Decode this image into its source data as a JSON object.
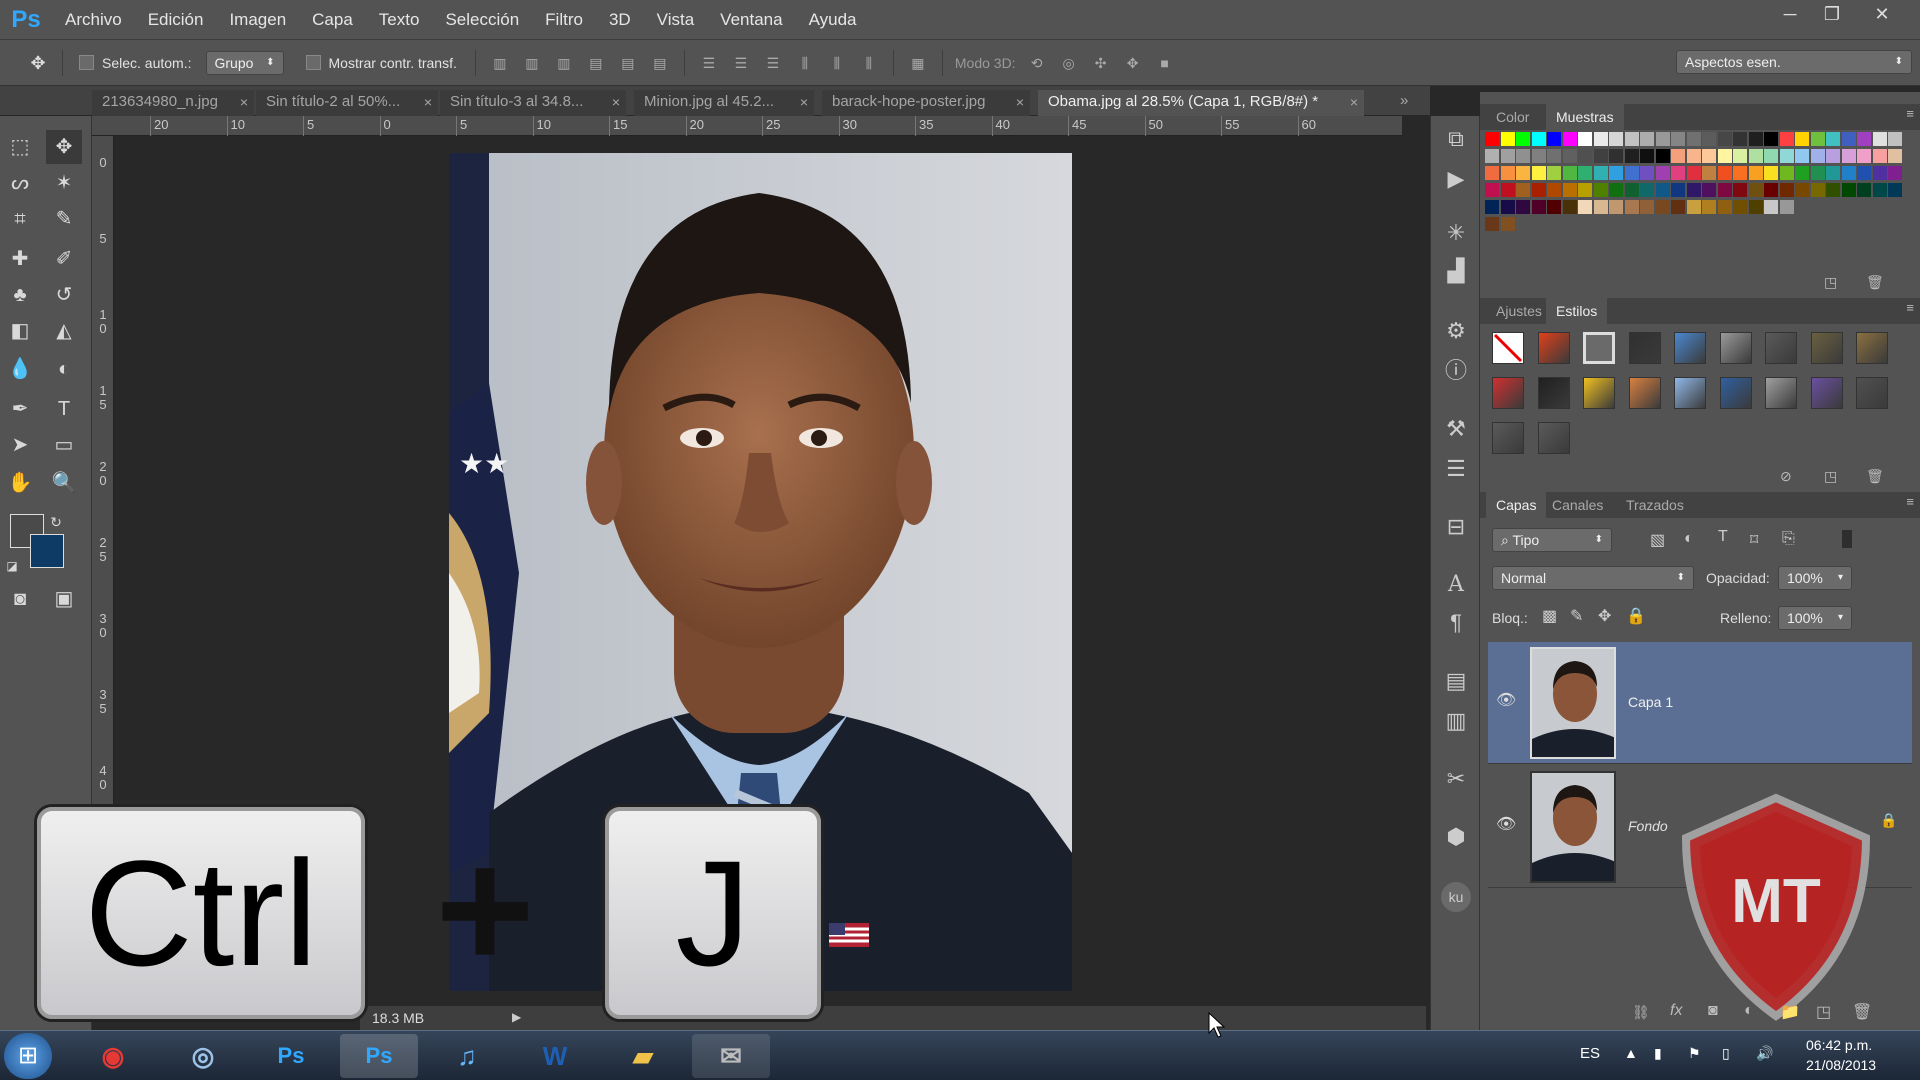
{
  "app": {
    "logo": "Ps"
  },
  "menu": [
    "Archivo",
    "Edición",
    "Imagen",
    "Capa",
    "Texto",
    "Selección",
    "Filtro",
    "3D",
    "Vista",
    "Ventana",
    "Ayuda"
  ],
  "window_controls": {
    "minimize": "─",
    "restore": "❐",
    "close": "✕"
  },
  "options": {
    "auto_select_label": "Selec. autom.:",
    "auto_select_mode": "Grupo",
    "show_transform_label": "Mostrar contr. transf.",
    "mode3d_label": "Modo 3D:",
    "workspace": "Aspectos esen."
  },
  "tabs": [
    {
      "label": "213634980_n.jpg",
      "active": false
    },
    {
      "label": "Sin título-2 al 50%...",
      "active": false
    },
    {
      "label": "Sin título-3 al 34.8...",
      "active": false
    },
    {
      "label": "Minion.jpg al 45.2...",
      "active": false
    },
    {
      "label": "barack-hope-poster.jpg",
      "active": false
    },
    {
      "label": "Obama.jpg al 28.5% (Capa 1, RGB/8#) *",
      "active": true
    }
  ],
  "ruler_h": [
    "20",
    "10",
    "5",
    "0",
    "5",
    "10",
    "15",
    "20",
    "25",
    "30",
    "35",
    "40",
    "45",
    "50",
    "55",
    "60"
  ],
  "ruler_v": [
    "0",
    "5",
    "1\n0",
    "1\n5",
    "2\n0",
    "2\n5",
    "3\n0",
    "3\n5",
    "4\n0"
  ],
  "status": {
    "doc_size": "18.3 MB"
  },
  "overlay_keys": {
    "key1": "Ctrl",
    "plus": "+",
    "key2": "J"
  },
  "panels": {
    "color_tabs": [
      "Color",
      "Muestras"
    ],
    "style_tabs": [
      "Ajustes",
      "Estilos"
    ],
    "layer_tabs": [
      "Capas",
      "Canales",
      "Trazados"
    ],
    "filter_kind": "Tipo",
    "blend_mode": "Normal",
    "opacity_label": "Opacidad:",
    "opacity_value": "100%",
    "lock_label": "Bloq.:",
    "fill_label": "Relleno:",
    "fill_value": "100%"
  },
  "layers": [
    {
      "name": "Capa 1",
      "selected": true
    },
    {
      "name": "Fondo",
      "selected": false
    }
  ],
  "watermark": "MT",
  "taskbar": {
    "lang": "ES",
    "time": "06:42 p.m.",
    "date": "21/08/2013"
  },
  "colors": {
    "accent": "#31a8ff",
    "selected_layer": "#5a6f93",
    "panel_bg": "#535353"
  }
}
